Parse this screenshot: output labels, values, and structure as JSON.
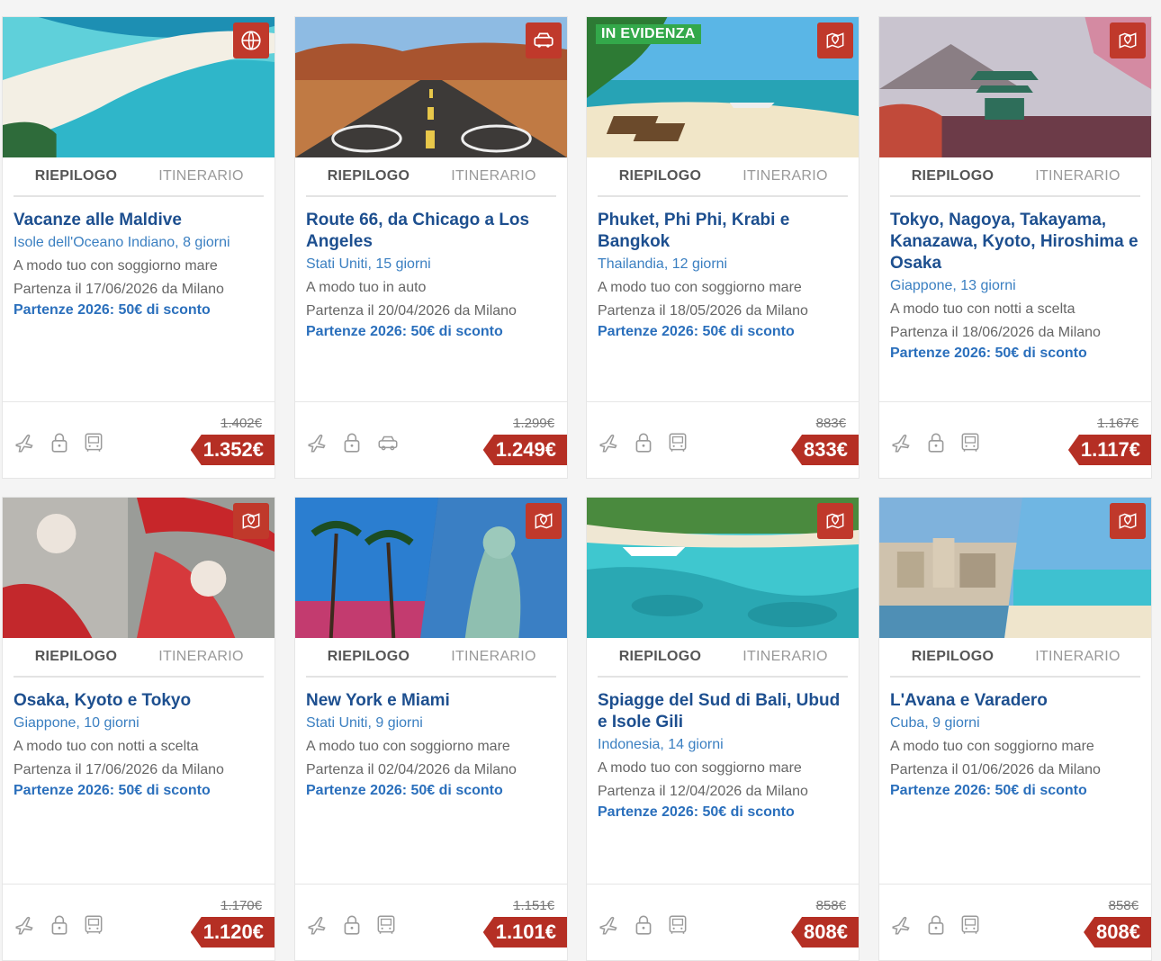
{
  "tabs": {
    "summary": "RIEPILOGO",
    "itinerary": "ITINERARIO"
  },
  "featured_label": "IN EVIDENZA",
  "promo": "Partenze 2026: 50€ di sconto",
  "colors": {
    "accent": "#b52f24",
    "title": "#1d4f8f",
    "destination": "#3a7fc1",
    "featured": "#33a84a"
  },
  "cards": [
    {
      "title": "Vacanze alle Maldive",
      "destination": "Isole dell'Oceano Indiano, 8 giorni",
      "type": "A modo tuo con soggiorno mare",
      "departure": "Partenza il 17/06/2026 da Milano",
      "old_price": "1.402€",
      "price": "1.352€",
      "badge_icon": "globe-icon",
      "transport_icon": "bus-icon"
    },
    {
      "title": "Route 66, da Chicago a Los Angeles",
      "destination": "Stati Uniti, 15 giorni",
      "type": "A modo tuo in auto",
      "departure": "Partenza il 20/04/2026 da Milano",
      "old_price": "1.299€",
      "price": "1.249€",
      "badge_icon": "car-icon",
      "transport_icon": "car-icon"
    },
    {
      "title": "Phuket, Phi Phi, Krabi e Bangkok",
      "destination": "Thailandia, 12 giorni",
      "type": "A modo tuo con soggiorno mare",
      "departure": "Partenza il 18/05/2026 da Milano",
      "old_price": "883€",
      "price": "833€",
      "badge_icon": "map-pin-icon",
      "transport_icon": "bus-icon"
    },
    {
      "title": "Tokyo, Nagoya, Takayama, Kanazawa, Kyoto, Hiroshima e Osaka",
      "destination": "Giappone, 13 giorni",
      "type": "A modo tuo con notti a scelta",
      "departure": "Partenza il 18/06/2026 da Milano",
      "old_price": "1.167€",
      "price": "1.117€",
      "badge_icon": "map-pin-icon",
      "transport_icon": "bus-icon"
    },
    {
      "title": "Osaka, Kyoto e Tokyo",
      "destination": "Giappone, 10 giorni",
      "type": "A modo tuo con notti a scelta",
      "departure": "Partenza il 17/06/2026 da Milano",
      "old_price": "1.170€",
      "price": "1.120€",
      "badge_icon": "map-pin-icon",
      "transport_icon": "bus-icon"
    },
    {
      "title": "New York e Miami",
      "destination": "Stati Uniti, 9 giorni",
      "type": "A modo tuo con soggiorno mare",
      "departure": "Partenza il 02/04/2026 da Milano",
      "old_price": "1.151€",
      "price": "1.101€",
      "badge_icon": "map-pin-icon",
      "transport_icon": "bus-icon"
    },
    {
      "title": "Spiagge del Sud di Bali, Ubud e Isole Gili",
      "destination": "Indonesia, 14 giorni",
      "type": "A modo tuo con soggiorno mare",
      "departure": "Partenza il 12/04/2026 da Milano",
      "old_price": "858€",
      "price": "808€",
      "badge_icon": "map-pin-icon",
      "transport_icon": "bus-icon"
    },
    {
      "title": "L'Avana e Varadero",
      "destination": "Cuba, 9 giorni",
      "type": "A modo tuo con soggiorno mare",
      "departure": "Partenza il 01/06/2026 da Milano",
      "old_price": "858€",
      "price": "808€",
      "badge_icon": "map-pin-icon",
      "transport_icon": "bus-icon"
    }
  ]
}
